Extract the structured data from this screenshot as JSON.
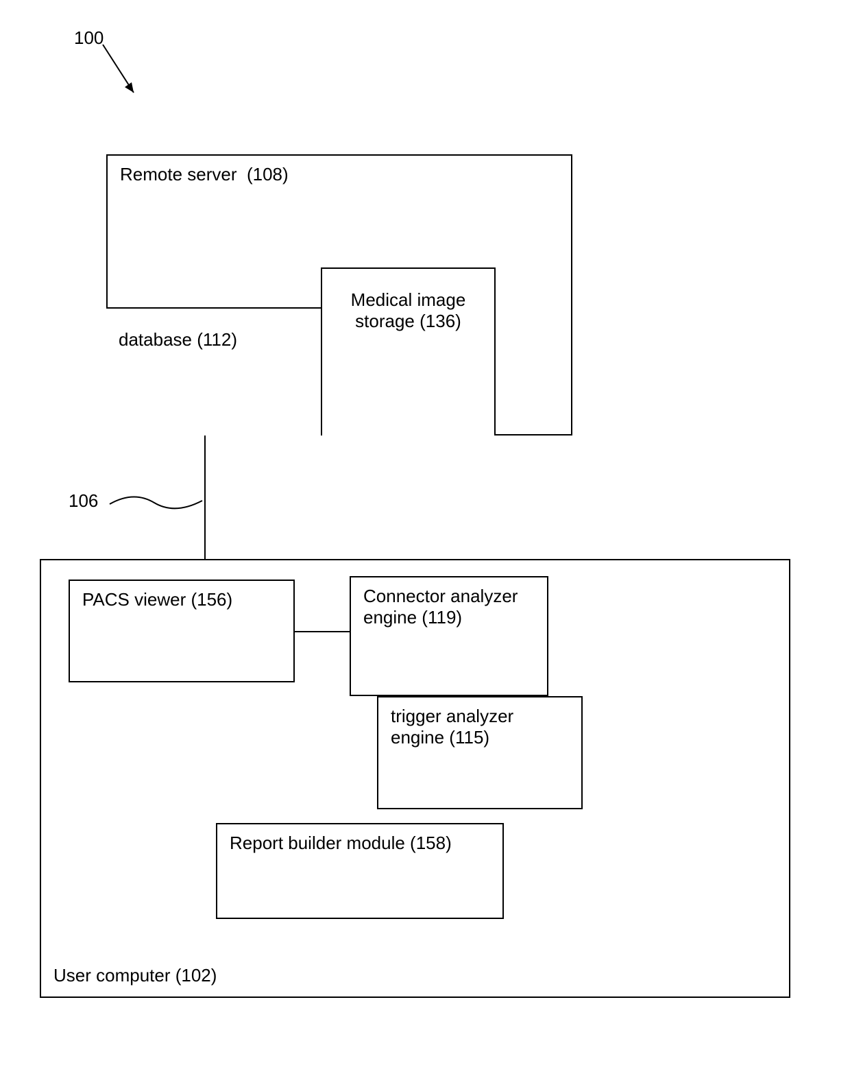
{
  "figure_ref": "100",
  "connector_ref": "106",
  "remote_server": {
    "title": "Remote server  (108)",
    "database": "database (112)",
    "storage": "Medical image storage (136)"
  },
  "user_computer": {
    "title": "User computer (102)",
    "pacs": "PACS viewer (156)",
    "connector_engine": "Connector analyzer engine (119)",
    "trigger_engine": "trigger analyzer engine (115)",
    "report_builder": "Report builder module (158)"
  }
}
